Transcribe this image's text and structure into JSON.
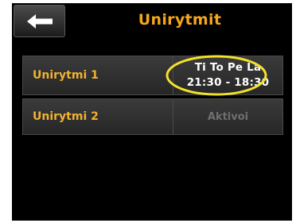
{
  "header": {
    "title": "Unirytmit",
    "back_icon": "back-arrow-icon"
  },
  "rows": [
    {
      "label": "Unirytmi 1",
      "days": "Ti To Pe La",
      "time": "21:30 - 18:30",
      "highlighted": true
    },
    {
      "label": "Unirytmi 2",
      "action": "Aktivoi"
    }
  ],
  "colors": {
    "accent": "#f4a61c",
    "label": "#f2b230",
    "highlight": "#f3e22a",
    "background": "#000000",
    "inactive_text": "#6f6f6f"
  }
}
